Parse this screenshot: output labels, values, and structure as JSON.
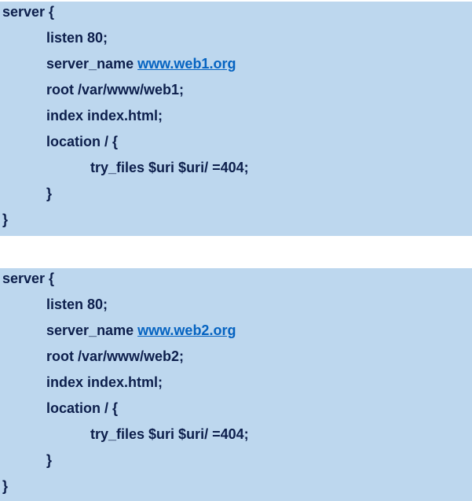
{
  "colors": {
    "block_background": "#bdd7ee",
    "text": "#0d1f4c",
    "link": "#0563c1"
  },
  "blocks": [
    {
      "open": "server {",
      "listen": "listen 80;",
      "server_name_keyword": "server_name ",
      "server_name_url": "www.web1.org",
      "root": "root /var/www/web1;",
      "index": "index index.html;",
      "location_open": "location / {",
      "try_files": "try_files $uri $uri/ =404;",
      "location_close": "}",
      "close": "}"
    },
    {
      "open": "server {",
      "listen": "listen 80;",
      "server_name_keyword": "server_name ",
      "server_name_url": "www.web2.org",
      "root": "root /var/www/web2;",
      "index": "index index.html;",
      "location_open": "location / {",
      "try_files": "try_files $uri $uri/ =404;",
      "location_close": "}",
      "close": "}"
    }
  ]
}
